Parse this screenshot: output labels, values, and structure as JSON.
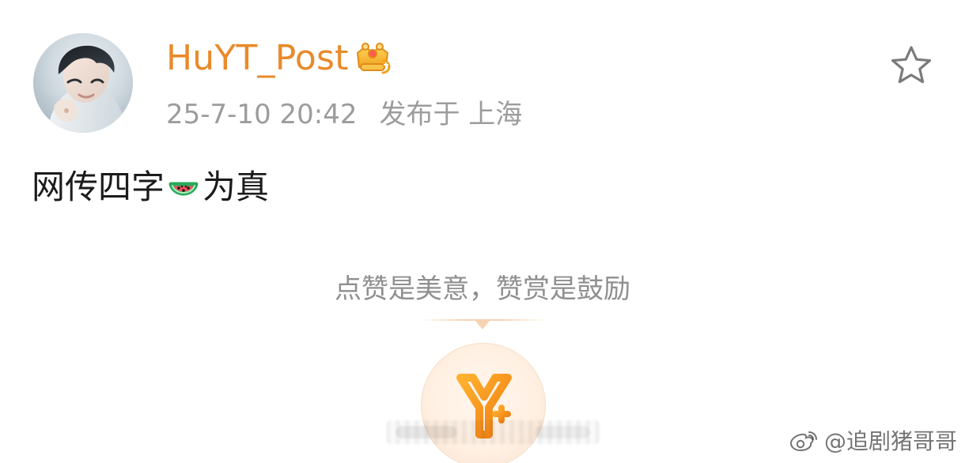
{
  "post": {
    "author": {
      "name": "HuYT_Post",
      "badge_icon": "crown-badge-icon"
    },
    "timestamp": "25-7-10 20:42",
    "location_text": "发布于 上海",
    "content": {
      "before_emoji": "网传四字",
      "emoji_icon": "watermelon-icon",
      "after_emoji": "为真"
    },
    "actions": {
      "favorite_icon": "star-icon"
    }
  },
  "reward": {
    "prompt": "点赞是美意，赞赏是鼓励",
    "button_icon": "reward-icon"
  },
  "watermark": {
    "text": "@追剧猪哥哥",
    "icon": "weibo-icon"
  },
  "colors": {
    "accent_orange": "#e88a2a",
    "meta_gray": "#9c9c9c",
    "text_black": "#1b1b1b",
    "reward_bg": "#fff0e2"
  }
}
